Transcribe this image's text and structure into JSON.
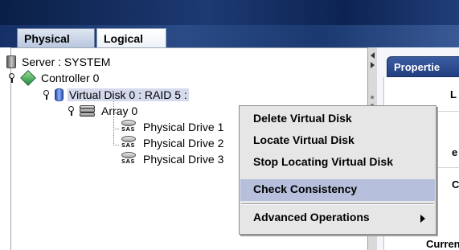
{
  "tabs": [
    {
      "label": "Physical",
      "active": false
    },
    {
      "label": "Logical",
      "active": true
    }
  ],
  "tree": {
    "server": "Server : SYSTEM",
    "controller": "Controller 0",
    "virtual_disk": "Virtual Disk 0 : RAID 5 :",
    "array": "Array 0",
    "drives": [
      "Physical Drive 1",
      "Physical Drive 2",
      "Physical Drive 3"
    ]
  },
  "properties": {
    "tab_label": "Propertie",
    "fragments": [
      "L",
      "e",
      "C",
      "Curren"
    ]
  },
  "context_menu": {
    "items": [
      {
        "label": "Delete Virtual Disk",
        "highlighted": false
      },
      {
        "label": "Locate Virtual Disk",
        "highlighted": false
      },
      {
        "label": "Stop Locating Virtual Disk",
        "highlighted": false
      },
      {
        "label": "Check Consistency",
        "highlighted": true
      },
      {
        "label": "Advanced Operations",
        "highlighted": false,
        "submenu": true
      }
    ]
  },
  "colors": {
    "banner": "#1d3a73",
    "selection": "#d5d9ec",
    "menu_highlight": "#b6c0dc"
  },
  "icons": [
    "server-icon",
    "controller-icon",
    "virtual-disk-icon",
    "array-icon",
    "sas-drive-icon",
    "expand-icon",
    "submenu-arrow-icon"
  ]
}
